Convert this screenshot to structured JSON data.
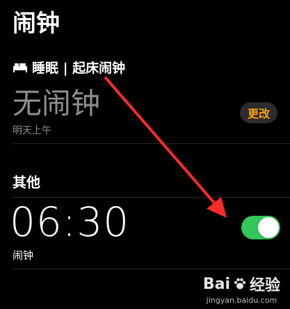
{
  "header": {
    "title": "闹钟"
  },
  "sleep": {
    "label": "睡眠 | 起床闹钟",
    "status": "无闹钟",
    "subtitle": "明天上午",
    "change_label": "更改"
  },
  "other": {
    "section_label": "其他",
    "alarm": {
      "time": "06:30",
      "label": "闹钟",
      "enabled": true
    }
  },
  "watermark": {
    "brand_a": "Bai",
    "brand_b": "经验",
    "url": "jingyan.baidu.com"
  },
  "colors": {
    "accent_orange": "#ff9f0a",
    "toggle_on": "#34c759",
    "arrow_red": "#ff2a2a",
    "dim_text": "#8e8e93"
  }
}
